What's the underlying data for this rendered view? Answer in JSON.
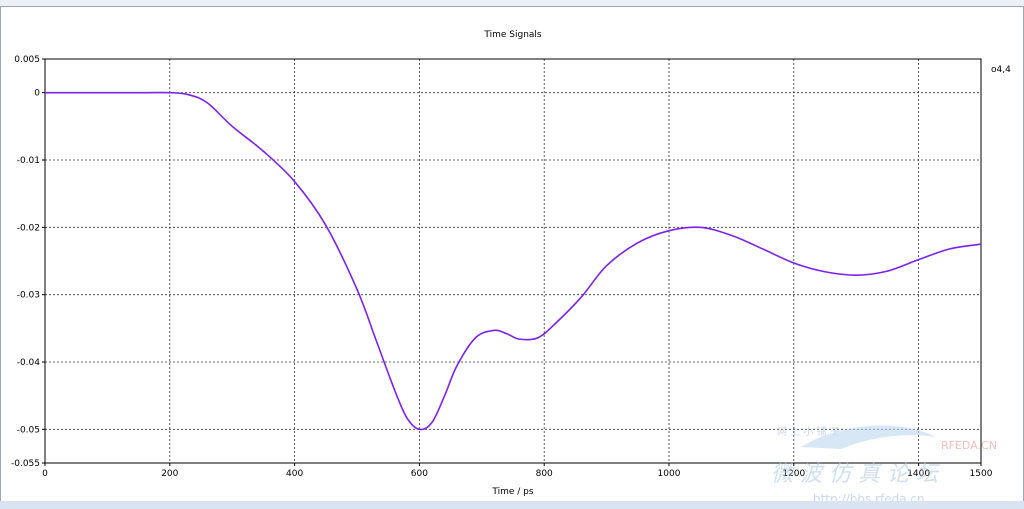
{
  "window": {
    "background": "#ffffff"
  },
  "chart_data": {
    "type": "line",
    "title": "Time Signals",
    "xlabel": "Time / ps",
    "ylabel": "",
    "xlim": [
      0,
      1500
    ],
    "ylim": [
      -0.055,
      0.005
    ],
    "x_ticks": [
      0,
      200,
      400,
      600,
      800,
      1000,
      1200,
      1400,
      1500
    ],
    "y_ticks": [
      0.005,
      0,
      -0.01,
      -0.02,
      -0.03,
      -0.04,
      -0.05,
      -0.055
    ],
    "x_gridlines": [
      200,
      400,
      600,
      800,
      1000,
      1200,
      1400
    ],
    "y_gridlines": [
      0,
      -0.01,
      -0.02,
      -0.03,
      -0.04,
      -0.05
    ],
    "grid": "dotted",
    "legend_placement": "top-right",
    "series": [
      {
        "name": "o4,4",
        "color": "#7b22ee",
        "x": [
          0,
          150,
          200,
          230,
          260,
          300,
          350,
          400,
          450,
          500,
          530,
          560,
          580,
          600,
          620,
          640,
          660,
          690,
          720,
          740,
          760,
          790,
          820,
          860,
          900,
          950,
          1000,
          1050,
          1100,
          1150,
          1200,
          1250,
          1300,
          1350,
          1400,
          1450,
          1500
        ],
        "y": [
          0,
          0,
          0,
          -0.0003,
          -0.0015,
          -0.005,
          -0.0087,
          -0.0132,
          -0.0197,
          -0.0292,
          -0.0366,
          -0.0441,
          -0.0483,
          -0.05,
          -0.049,
          -0.0451,
          -0.0406,
          -0.0364,
          -0.0353,
          -0.0358,
          -0.0366,
          -0.0364,
          -0.0341,
          -0.0303,
          -0.0257,
          -0.0223,
          -0.0205,
          -0.02,
          -0.0212,
          -0.0232,
          -0.0253,
          -0.0266,
          -0.0271,
          -0.0265,
          -0.0248,
          -0.0232,
          -0.0225
        ]
      }
    ]
  },
  "watermark": {
    "brand": "RFEDA.CN",
    "cn_top": "网 上 小 铺 子",
    "cn_main": "微 波 仿 真 论 坛",
    "url": "http://bbs.rfeda.cn"
  }
}
